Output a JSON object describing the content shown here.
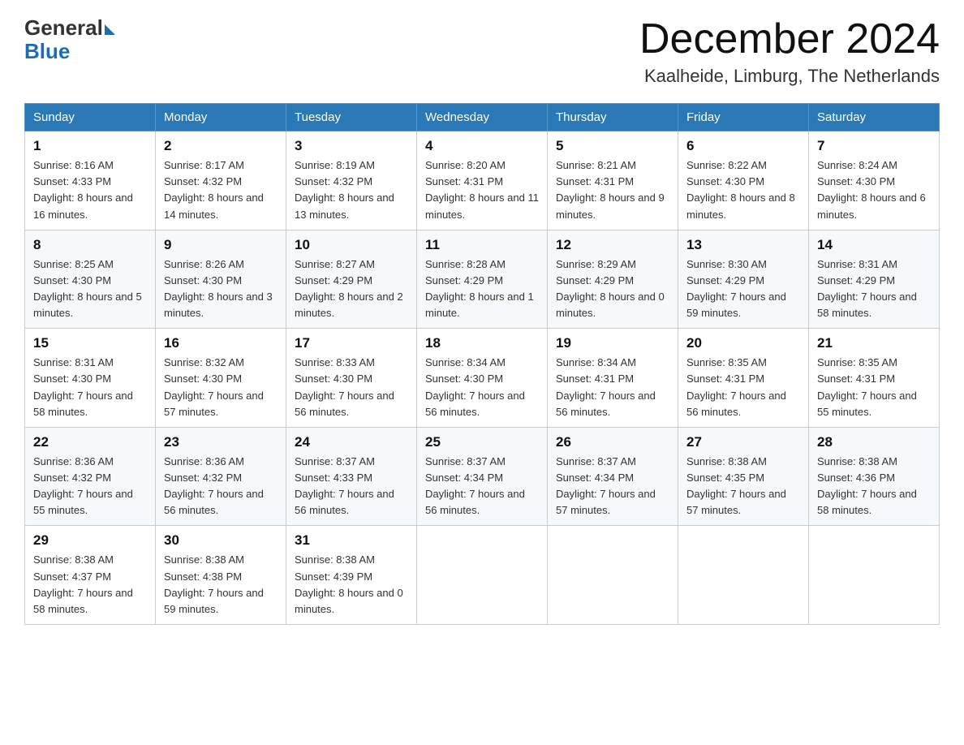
{
  "header": {
    "logo_text_black": "General",
    "logo_text_blue": "Blue",
    "month_year": "December 2024",
    "location": "Kaalheide, Limburg, The Netherlands"
  },
  "weekdays": [
    "Sunday",
    "Monday",
    "Tuesday",
    "Wednesday",
    "Thursday",
    "Friday",
    "Saturday"
  ],
  "weeks": [
    [
      {
        "day": "1",
        "sunrise": "8:16 AM",
        "sunset": "4:33 PM",
        "daylight": "8 hours and 16 minutes."
      },
      {
        "day": "2",
        "sunrise": "8:17 AM",
        "sunset": "4:32 PM",
        "daylight": "8 hours and 14 minutes."
      },
      {
        "day": "3",
        "sunrise": "8:19 AM",
        "sunset": "4:32 PM",
        "daylight": "8 hours and 13 minutes."
      },
      {
        "day": "4",
        "sunrise": "8:20 AM",
        "sunset": "4:31 PM",
        "daylight": "8 hours and 11 minutes."
      },
      {
        "day": "5",
        "sunrise": "8:21 AM",
        "sunset": "4:31 PM",
        "daylight": "8 hours and 9 minutes."
      },
      {
        "day": "6",
        "sunrise": "8:22 AM",
        "sunset": "4:30 PM",
        "daylight": "8 hours and 8 minutes."
      },
      {
        "day": "7",
        "sunrise": "8:24 AM",
        "sunset": "4:30 PM",
        "daylight": "8 hours and 6 minutes."
      }
    ],
    [
      {
        "day": "8",
        "sunrise": "8:25 AM",
        "sunset": "4:30 PM",
        "daylight": "8 hours and 5 minutes."
      },
      {
        "day": "9",
        "sunrise": "8:26 AM",
        "sunset": "4:30 PM",
        "daylight": "8 hours and 3 minutes."
      },
      {
        "day": "10",
        "sunrise": "8:27 AM",
        "sunset": "4:29 PM",
        "daylight": "8 hours and 2 minutes."
      },
      {
        "day": "11",
        "sunrise": "8:28 AM",
        "sunset": "4:29 PM",
        "daylight": "8 hours and 1 minute."
      },
      {
        "day": "12",
        "sunrise": "8:29 AM",
        "sunset": "4:29 PM",
        "daylight": "8 hours and 0 minutes."
      },
      {
        "day": "13",
        "sunrise": "8:30 AM",
        "sunset": "4:29 PM",
        "daylight": "7 hours and 59 minutes."
      },
      {
        "day": "14",
        "sunrise": "8:31 AM",
        "sunset": "4:29 PM",
        "daylight": "7 hours and 58 minutes."
      }
    ],
    [
      {
        "day": "15",
        "sunrise": "8:31 AM",
        "sunset": "4:30 PM",
        "daylight": "7 hours and 58 minutes."
      },
      {
        "day": "16",
        "sunrise": "8:32 AM",
        "sunset": "4:30 PM",
        "daylight": "7 hours and 57 minutes."
      },
      {
        "day": "17",
        "sunrise": "8:33 AM",
        "sunset": "4:30 PM",
        "daylight": "7 hours and 56 minutes."
      },
      {
        "day": "18",
        "sunrise": "8:34 AM",
        "sunset": "4:30 PM",
        "daylight": "7 hours and 56 minutes."
      },
      {
        "day": "19",
        "sunrise": "8:34 AM",
        "sunset": "4:31 PM",
        "daylight": "7 hours and 56 minutes."
      },
      {
        "day": "20",
        "sunrise": "8:35 AM",
        "sunset": "4:31 PM",
        "daylight": "7 hours and 56 minutes."
      },
      {
        "day": "21",
        "sunrise": "8:35 AM",
        "sunset": "4:31 PM",
        "daylight": "7 hours and 55 minutes."
      }
    ],
    [
      {
        "day": "22",
        "sunrise": "8:36 AM",
        "sunset": "4:32 PM",
        "daylight": "7 hours and 55 minutes."
      },
      {
        "day": "23",
        "sunrise": "8:36 AM",
        "sunset": "4:32 PM",
        "daylight": "7 hours and 56 minutes."
      },
      {
        "day": "24",
        "sunrise": "8:37 AM",
        "sunset": "4:33 PM",
        "daylight": "7 hours and 56 minutes."
      },
      {
        "day": "25",
        "sunrise": "8:37 AM",
        "sunset": "4:34 PM",
        "daylight": "7 hours and 56 minutes."
      },
      {
        "day": "26",
        "sunrise": "8:37 AM",
        "sunset": "4:34 PM",
        "daylight": "7 hours and 57 minutes."
      },
      {
        "day": "27",
        "sunrise": "8:38 AM",
        "sunset": "4:35 PM",
        "daylight": "7 hours and 57 minutes."
      },
      {
        "day": "28",
        "sunrise": "8:38 AM",
        "sunset": "4:36 PM",
        "daylight": "7 hours and 58 minutes."
      }
    ],
    [
      {
        "day": "29",
        "sunrise": "8:38 AM",
        "sunset": "4:37 PM",
        "daylight": "7 hours and 58 minutes."
      },
      {
        "day": "30",
        "sunrise": "8:38 AM",
        "sunset": "4:38 PM",
        "daylight": "7 hours and 59 minutes."
      },
      {
        "day": "31",
        "sunrise": "8:38 AM",
        "sunset": "4:39 PM",
        "daylight": "8 hours and 0 minutes."
      },
      null,
      null,
      null,
      null
    ]
  ]
}
